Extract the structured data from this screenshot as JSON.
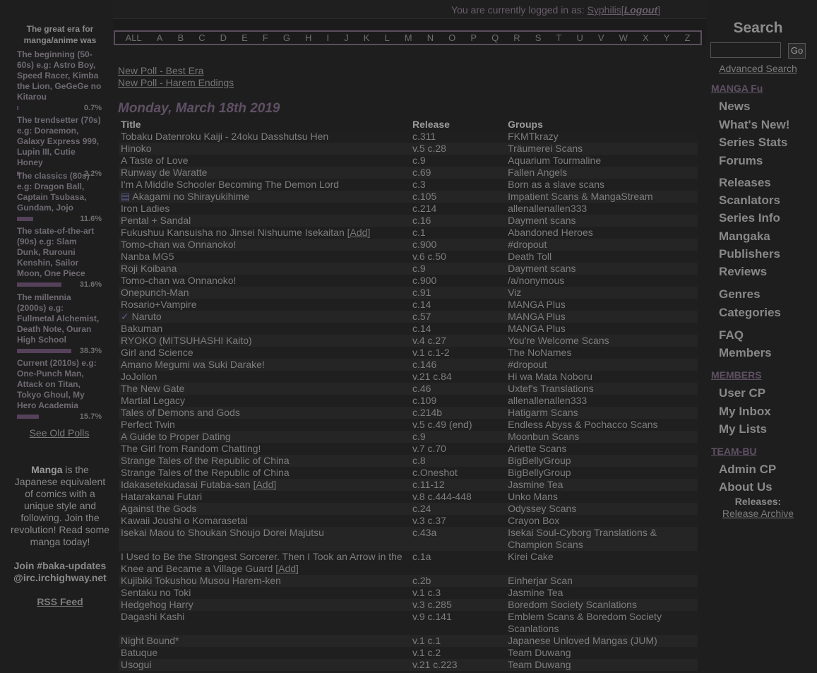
{
  "header": {
    "login_prefix": "You are currently logged in as:",
    "username": "Syphilis",
    "bracket_open": "[",
    "logout": "Logout",
    "bracket_close": "]"
  },
  "letters": [
    "ALL",
    "A",
    "B",
    "C",
    "D",
    "E",
    "F",
    "G",
    "H",
    "I",
    "J",
    "K",
    "L",
    "M",
    "N",
    "O",
    "P",
    "Q",
    "R",
    "S",
    "T",
    "U",
    "V",
    "W",
    "X",
    "Y",
    "Z"
  ],
  "poll": {
    "question": "The great era for manga/anime was",
    "options": [
      {
        "label": "The beginning (50-60s) e.g: Astro Boy, Speed Racer, Kimba the Lion, GeGeGe no Kitarou",
        "pct": "0.7%",
        "value": 0.7
      },
      {
        "label": "The trendsetter (70s) e.g: Doraemon, Galaxy Express 999, Lupin III, Cutie Honey",
        "pct": "2.2%",
        "value": 2.2
      },
      {
        "label": "The classics (80s) e.g: Dragon Ball, Captain Tsubasa, Gundam, Jojo",
        "pct": "11.6%",
        "value": 11.6
      },
      {
        "label": "The state-of-the-art (90s) e.g: Slam Dunk, Rurouni Kenshin, Sailor Moon, One Piece",
        "pct": "31.6%",
        "value": 31.6
      },
      {
        "label": "The millennia (2000s) e.g: Fullmetal Alchemist, Death Note, Ouran High School",
        "pct": "38.3%",
        "value": 38.3
      },
      {
        "label": "Current (2010s) e.g: One-Punch Man, Attack on Titan, Tokyo Ghoul, My Hero Academia",
        "pct": "15.7%",
        "value": 15.7
      }
    ],
    "old_polls": "See Old Polls"
  },
  "blurb": {
    "manga_bold": "Manga",
    "text": " is the Japanese equivalent of comics with a unique style and following. Join the revolution! Read some manga today!",
    "irc_line1": "Join #baka-updates",
    "irc_line2": "@irc.irchighway.net",
    "rss": "RSS Feed"
  },
  "center": {
    "poll_link1": "New Poll - Best Era",
    "poll_link2": "New Poll - Harem Endings",
    "date": "Monday, March 18th 2019",
    "columns": {
      "title": "Title",
      "release": "Release",
      "groups": "Groups"
    },
    "add_label": "[Add]",
    "rows": [
      {
        "title": "Tobaku Datenroku Kaiji - 24oku Dasshutsu Hen",
        "release": "c.311",
        "group": "FKMTkrazy"
      },
      {
        "title": "Hinoko",
        "release": "v.5 c.28",
        "group": "Träumerei Scans"
      },
      {
        "title": "A Taste of Love",
        "release": "c.9",
        "group": "Aquarium Tourmaline"
      },
      {
        "title": "Runway de Waratte",
        "release": "c.69",
        "group": "Fallen Angels"
      },
      {
        "title": "I'm A Middle Schooler Becoming The Demon Lord",
        "release": "c.3",
        "group": "Born as a slave scans"
      },
      {
        "title": "Akagami no Shirayukihime",
        "release": "c.105",
        "group": "Impatient Scans & MangaStream",
        "icon": "list-icon"
      },
      {
        "title": "Iron Ladies",
        "release": "c.214",
        "group": "allenallenallen333"
      },
      {
        "title": "Pental + Sandal",
        "release": "c.16",
        "group": "Dayment scans"
      },
      {
        "title": "Fukushuu Kansuisha no Jinsei Nishuume Isekaitan",
        "release": "c.1",
        "group": "Abandoned Heroes",
        "add": true
      },
      {
        "title": "Tomo-chan wa Onnanoko!",
        "release": "c.900",
        "group": "#dropout"
      },
      {
        "title": "Nanba MG5",
        "release": "v.6 c.50",
        "group": "Death Toll"
      },
      {
        "title": "Roji Koibana",
        "release": "c.9",
        "group": "Dayment scans"
      },
      {
        "title": "Tomo-chan wa Onnanoko!",
        "release": "c.900",
        "group": "/a/nonymous"
      },
      {
        "title": "Onepunch-Man",
        "release": "c.91",
        "group": "Viz"
      },
      {
        "title": "Rosario+Vampire",
        "release": "c.14",
        "group": "MANGA Plus"
      },
      {
        "title": "Naruto",
        "release": "c.57",
        "group": "MANGA Plus",
        "icon": "check-icon"
      },
      {
        "title": "Bakuman",
        "release": "c.14",
        "group": "MANGA Plus"
      },
      {
        "title": "RYOKO (MITSUHASHI Kaito)",
        "release": "v.4 c.27",
        "group": "You're Welcome Scans"
      },
      {
        "title": "Girl and Science",
        "release": "v.1 c.1-2",
        "group": "The NoNames"
      },
      {
        "title": "Amano Megumi wa Suki Darake!",
        "release": "c.146",
        "group": "#dropout"
      },
      {
        "title": "JoJolion",
        "release": "v.21 c.84",
        "group": "Hi wa Mata Noboru"
      },
      {
        "title": "The New Gate",
        "release": "c.46",
        "group": "Uxtef's Translations"
      },
      {
        "title": "Martial Legacy",
        "release": "c.109",
        "group": "allenallenallen333"
      },
      {
        "title": "Tales of Demons and Gods",
        "release": "c.214b",
        "group": "Hatigarm Scans"
      },
      {
        "title": "Perfect Twin",
        "release": "v.5 c.49 (end)",
        "group": "Endless Abyss & Pochacco Scans"
      },
      {
        "title": "A Guide to Proper Dating",
        "release": "c.9",
        "group": "Moonbun Scans"
      },
      {
        "title": "The Girl from Random Chatting!",
        "release": "v.7 c.70",
        "group": "Ariette Scans"
      },
      {
        "title": "Strange Tales of the Republic of China",
        "release": "c.8",
        "group": "BigBellyGroup"
      },
      {
        "title": "Strange Tales of the Republic of China",
        "release": "c.Oneshot",
        "group": "BigBellyGroup"
      },
      {
        "title": "Idakasetekudasai Futaba-san",
        "release": "c.11-12",
        "group": "Jasmine Tea",
        "add": true
      },
      {
        "title": "Hatarakanai Futari",
        "release": "v.8 c.444-448",
        "group": "Unko Mans"
      },
      {
        "title": "Against the Gods",
        "release": "c.24",
        "group": "Odyssey Scans"
      },
      {
        "title": "Kawaii Joushi o Komarasetai",
        "release": "v.3 c.37",
        "group": "Crayon Box"
      },
      {
        "title": "Isekai Maou to Shoukan Shoujo Dorei Majutsu",
        "release": "c.43a",
        "group": "Isekai Soul-Cyborg Translations & Champion Scans"
      },
      {
        "title": "I Used to Be the Strongest Sorcerer. Then I Took an Arrow in the Knee and Became a Village Guard",
        "release": "c.1a",
        "group": "Kirei Cake",
        "add": true
      },
      {
        "title": "Kujibiki Tokushou Musou Harem-ken",
        "release": "c.2b",
        "group": "Einherjar Scan"
      },
      {
        "title": "Sentaku no Toki",
        "release": "v.1 c.3",
        "group": "Jasmine Tea"
      },
      {
        "title": "Hedgehog Harry",
        "release": "v.3 c.285",
        "group": "Boredom Society Scanlations"
      },
      {
        "title": "Dagashi Kashi",
        "release": "v.9 c.141",
        "group": "Emblem Scans & Boredom Society Scanlations"
      },
      {
        "title": "Night Bound*",
        "release": "v.1 c.1",
        "group": "Japanese Unloved Mangas (JUM)"
      },
      {
        "title": "Batuque",
        "release": "v.1 c.2",
        "group": "Team Duwang"
      },
      {
        "title": "Usogui",
        "release": "v.21 c.223",
        "group": "Team Duwang"
      }
    ]
  },
  "right": {
    "search_title": "Search",
    "search_value": "",
    "go": "Go",
    "advanced": "Advanced Search",
    "section_manga": "MANGA Fu",
    "manga_items": [
      "News",
      "What's New!",
      "Series Stats",
      "Forums"
    ],
    "db_items": [
      "Releases",
      "Scanlators",
      "Series Info",
      "Mangaka",
      "Publishers",
      "Reviews"
    ],
    "cat_items": [
      "Genres",
      "Categories"
    ],
    "misc_items": [
      "FAQ",
      "Members"
    ],
    "section_members": "MEMBERS",
    "member_items": [
      "User CP",
      "My Inbox",
      "My Lists"
    ],
    "section_team": "TEAM-BU",
    "team_items": [
      "Admin CP",
      "About Us"
    ],
    "releases_label": "Releases:",
    "release_archive": "Release Archive"
  }
}
